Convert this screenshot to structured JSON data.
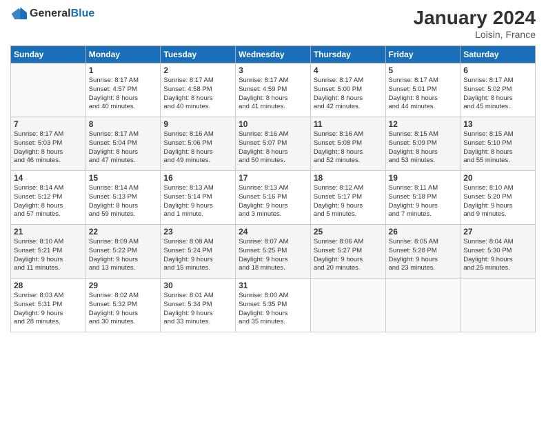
{
  "header": {
    "logo_general": "General",
    "logo_blue": "Blue",
    "title": "January 2024",
    "subtitle": "Loisin, France"
  },
  "columns": [
    "Sunday",
    "Monday",
    "Tuesday",
    "Wednesday",
    "Thursday",
    "Friday",
    "Saturday"
  ],
  "weeks": [
    [
      {
        "day": "",
        "sunrise": "",
        "sunset": "",
        "daylight": ""
      },
      {
        "day": "1",
        "sunrise": "Sunrise: 8:17 AM",
        "sunset": "Sunset: 4:57 PM",
        "daylight": "Daylight: 8 hours and 40 minutes."
      },
      {
        "day": "2",
        "sunrise": "Sunrise: 8:17 AM",
        "sunset": "Sunset: 4:58 PM",
        "daylight": "Daylight: 8 hours and 40 minutes."
      },
      {
        "day": "3",
        "sunrise": "Sunrise: 8:17 AM",
        "sunset": "Sunset: 4:59 PM",
        "daylight": "Daylight: 8 hours and 41 minutes."
      },
      {
        "day": "4",
        "sunrise": "Sunrise: 8:17 AM",
        "sunset": "Sunset: 5:00 PM",
        "daylight": "Daylight: 8 hours and 42 minutes."
      },
      {
        "day": "5",
        "sunrise": "Sunrise: 8:17 AM",
        "sunset": "Sunset: 5:01 PM",
        "daylight": "Daylight: 8 hours and 44 minutes."
      },
      {
        "day": "6",
        "sunrise": "Sunrise: 8:17 AM",
        "sunset": "Sunset: 5:02 PM",
        "daylight": "Daylight: 8 hours and 45 minutes."
      }
    ],
    [
      {
        "day": "7",
        "sunrise": "Sunrise: 8:17 AM",
        "sunset": "Sunset: 5:03 PM",
        "daylight": "Daylight: 8 hours and 46 minutes."
      },
      {
        "day": "8",
        "sunrise": "Sunrise: 8:17 AM",
        "sunset": "Sunset: 5:04 PM",
        "daylight": "Daylight: 8 hours and 47 minutes."
      },
      {
        "day": "9",
        "sunrise": "Sunrise: 8:16 AM",
        "sunset": "Sunset: 5:06 PM",
        "daylight": "Daylight: 8 hours and 49 minutes."
      },
      {
        "day": "10",
        "sunrise": "Sunrise: 8:16 AM",
        "sunset": "Sunset: 5:07 PM",
        "daylight": "Daylight: 8 hours and 50 minutes."
      },
      {
        "day": "11",
        "sunrise": "Sunrise: 8:16 AM",
        "sunset": "Sunset: 5:08 PM",
        "daylight": "Daylight: 8 hours and 52 minutes."
      },
      {
        "day": "12",
        "sunrise": "Sunrise: 8:15 AM",
        "sunset": "Sunset: 5:09 PM",
        "daylight": "Daylight: 8 hours and 53 minutes."
      },
      {
        "day": "13",
        "sunrise": "Sunrise: 8:15 AM",
        "sunset": "Sunset: 5:10 PM",
        "daylight": "Daylight: 8 hours and 55 minutes."
      }
    ],
    [
      {
        "day": "14",
        "sunrise": "Sunrise: 8:14 AM",
        "sunset": "Sunset: 5:12 PM",
        "daylight": "Daylight: 8 hours and 57 minutes."
      },
      {
        "day": "15",
        "sunrise": "Sunrise: 8:14 AM",
        "sunset": "Sunset: 5:13 PM",
        "daylight": "Daylight: 8 hours and 59 minutes."
      },
      {
        "day": "16",
        "sunrise": "Sunrise: 8:13 AM",
        "sunset": "Sunset: 5:14 PM",
        "daylight": "Daylight: 9 hours and 1 minute."
      },
      {
        "day": "17",
        "sunrise": "Sunrise: 8:13 AM",
        "sunset": "Sunset: 5:16 PM",
        "daylight": "Daylight: 9 hours and 3 minutes."
      },
      {
        "day": "18",
        "sunrise": "Sunrise: 8:12 AM",
        "sunset": "Sunset: 5:17 PM",
        "daylight": "Daylight: 9 hours and 5 minutes."
      },
      {
        "day": "19",
        "sunrise": "Sunrise: 8:11 AM",
        "sunset": "Sunset: 5:18 PM",
        "daylight": "Daylight: 9 hours and 7 minutes."
      },
      {
        "day": "20",
        "sunrise": "Sunrise: 8:10 AM",
        "sunset": "Sunset: 5:20 PM",
        "daylight": "Daylight: 9 hours and 9 minutes."
      }
    ],
    [
      {
        "day": "21",
        "sunrise": "Sunrise: 8:10 AM",
        "sunset": "Sunset: 5:21 PM",
        "daylight": "Daylight: 9 hours and 11 minutes."
      },
      {
        "day": "22",
        "sunrise": "Sunrise: 8:09 AM",
        "sunset": "Sunset: 5:22 PM",
        "daylight": "Daylight: 9 hours and 13 minutes."
      },
      {
        "day": "23",
        "sunrise": "Sunrise: 8:08 AM",
        "sunset": "Sunset: 5:24 PM",
        "daylight": "Daylight: 9 hours and 15 minutes."
      },
      {
        "day": "24",
        "sunrise": "Sunrise: 8:07 AM",
        "sunset": "Sunset: 5:25 PM",
        "daylight": "Daylight: 9 hours and 18 minutes."
      },
      {
        "day": "25",
        "sunrise": "Sunrise: 8:06 AM",
        "sunset": "Sunset: 5:27 PM",
        "daylight": "Daylight: 9 hours and 20 minutes."
      },
      {
        "day": "26",
        "sunrise": "Sunrise: 8:05 AM",
        "sunset": "Sunset: 5:28 PM",
        "daylight": "Daylight: 9 hours and 23 minutes."
      },
      {
        "day": "27",
        "sunrise": "Sunrise: 8:04 AM",
        "sunset": "Sunset: 5:30 PM",
        "daylight": "Daylight: 9 hours and 25 minutes."
      }
    ],
    [
      {
        "day": "28",
        "sunrise": "Sunrise: 8:03 AM",
        "sunset": "Sunset: 5:31 PM",
        "daylight": "Daylight: 9 hours and 28 minutes."
      },
      {
        "day": "29",
        "sunrise": "Sunrise: 8:02 AM",
        "sunset": "Sunset: 5:32 PM",
        "daylight": "Daylight: 9 hours and 30 minutes."
      },
      {
        "day": "30",
        "sunrise": "Sunrise: 8:01 AM",
        "sunset": "Sunset: 5:34 PM",
        "daylight": "Daylight: 9 hours and 33 minutes."
      },
      {
        "day": "31",
        "sunrise": "Sunrise: 8:00 AM",
        "sunset": "Sunset: 5:35 PM",
        "daylight": "Daylight: 9 hours and 35 minutes."
      },
      {
        "day": "",
        "sunrise": "",
        "sunset": "",
        "daylight": ""
      },
      {
        "day": "",
        "sunrise": "",
        "sunset": "",
        "daylight": ""
      },
      {
        "day": "",
        "sunrise": "",
        "sunset": "",
        "daylight": ""
      }
    ]
  ]
}
